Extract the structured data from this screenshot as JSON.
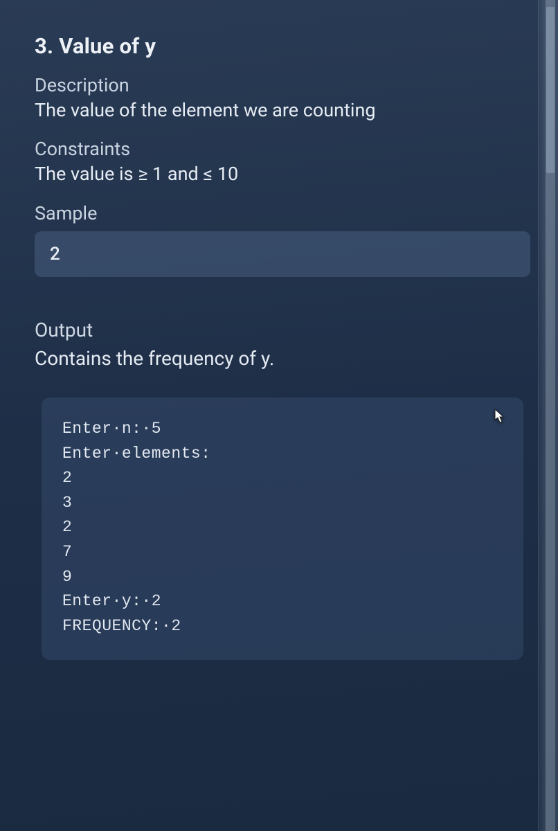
{
  "section": {
    "title": "3. Value of y",
    "description_label": "Description",
    "description_text": "The value of the element we are counting",
    "constraints_label": "Constraints",
    "constraints_text": "The value is ≥ 1 and ≤ 10",
    "sample_label": "Sample",
    "sample_value": "2"
  },
  "output": {
    "label": "Output",
    "text": "Contains the frequency of y.",
    "code": "Enter·n:·5\nEnter·elements:\n2\n3\n2\n7\n9\nEnter·y:·2\nFREQUENCY:·2"
  }
}
